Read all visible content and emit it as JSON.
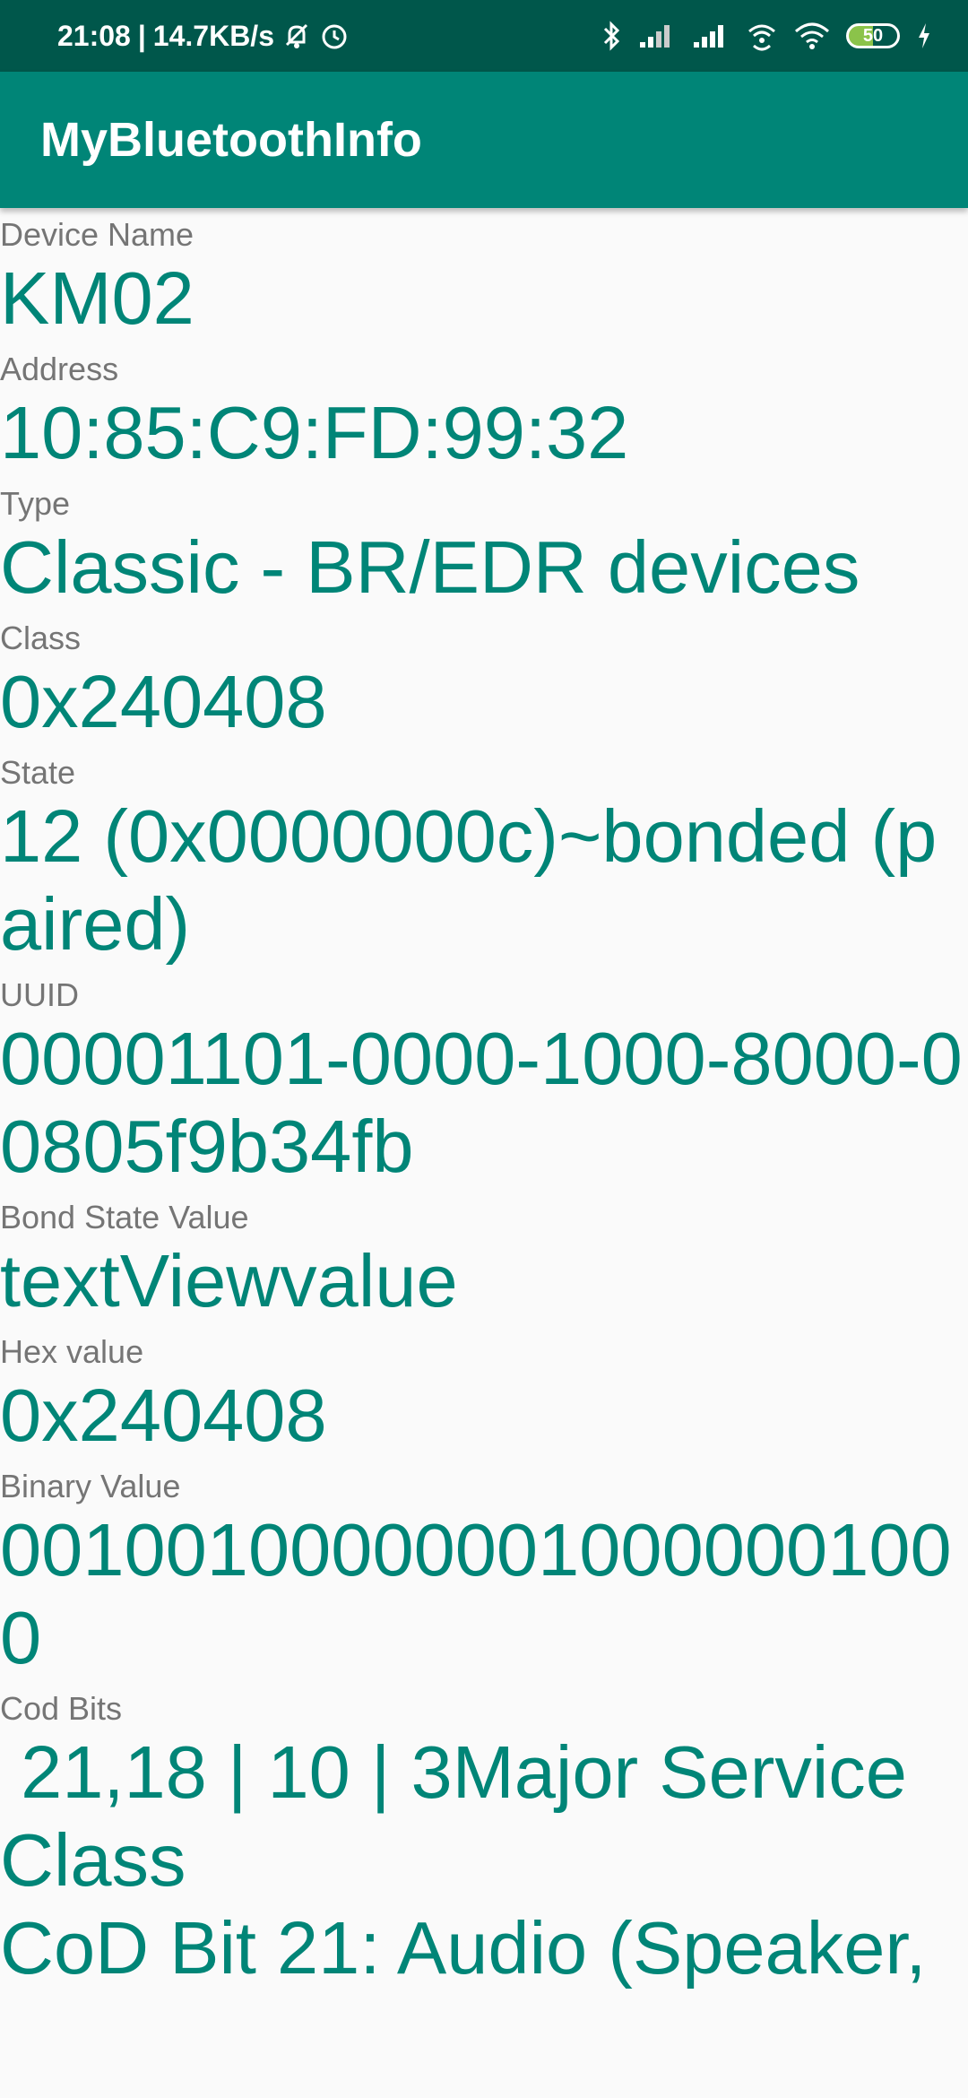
{
  "status_bar": {
    "time": "21:08",
    "net_speed": "14.7KB/s",
    "battery_level": "50",
    "icons": [
      "mute-icon",
      "alarm-icon",
      "bluetooth-icon",
      "signal-icon",
      "signal-icon",
      "hotspot-icon",
      "wifi-icon",
      "battery-icon",
      "charging-icon"
    ]
  },
  "app_bar": {
    "title": "MyBluetoothInfo"
  },
  "fields": [
    {
      "label": "Device Name",
      "value": "KM02"
    },
    {
      "label": "Address",
      "value": "10:85:C9:FD:99:32"
    },
    {
      "label": "Type",
      "value": "Classic - BR/EDR devices"
    },
    {
      "label": "Class",
      "value": "0x240408"
    },
    {
      "label": "State",
      "value": "12 (0x0000000c)~bonded (paired)"
    },
    {
      "label": "UUID",
      "value": "00001101-0000-1000-8000-00805f9b34fb"
    },
    {
      "label": "Bond State Value",
      "value": "textViewvalue"
    },
    {
      "label": "Hex value",
      "value": "0x240408"
    },
    {
      "label": "Binary Value",
      "value": "001001000000010000001000"
    },
    {
      "label": "Cod Bits",
      "value": " 21,18 | 10 | 3Major Service Class\nCoD Bit 21: Audio (Speaker,"
    }
  ],
  "colors": {
    "status_bar": "#00574b",
    "app_bar": "#008577",
    "value_text": "#008577",
    "label_text": "#757575",
    "background": "#fafafa"
  }
}
